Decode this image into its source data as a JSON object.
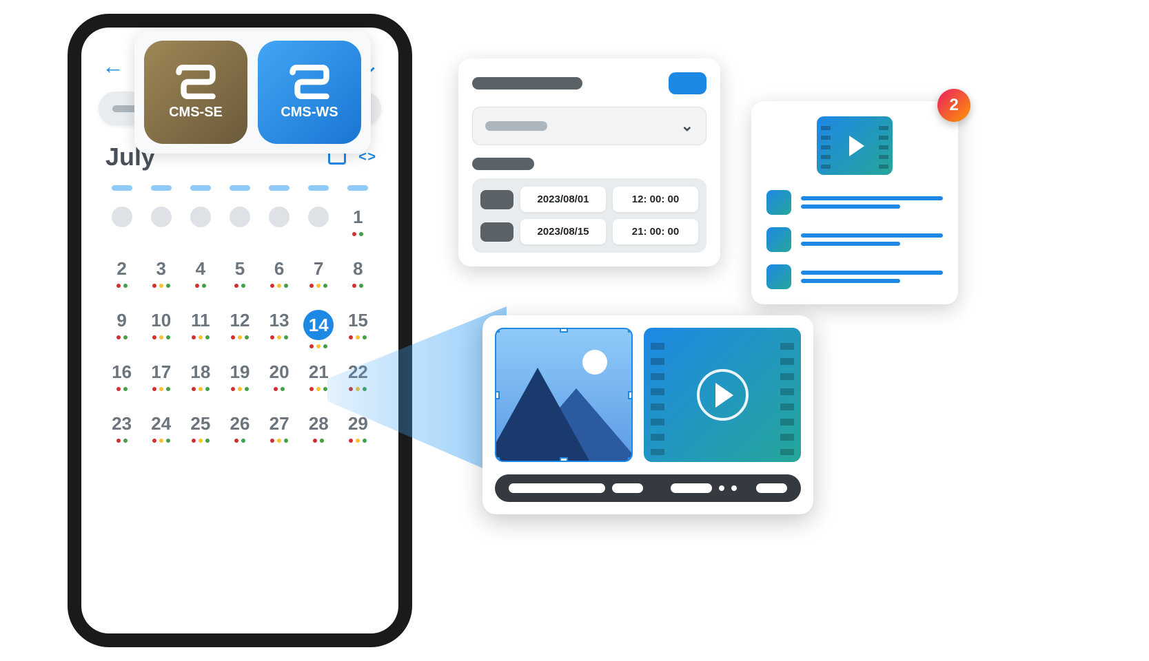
{
  "apps": {
    "cms_se": "CMS-SE",
    "cms_ws": "CMS-WS"
  },
  "calendar": {
    "month": "July",
    "selected_day": 14,
    "grid": [
      {
        "n": null,
        "dots": []
      },
      {
        "n": null,
        "dots": []
      },
      {
        "n": null,
        "dots": []
      },
      {
        "n": null,
        "dots": []
      },
      {
        "n": null,
        "dots": []
      },
      {
        "n": null,
        "dots": []
      },
      {
        "n": 1,
        "dots": [
          "r",
          "g"
        ]
      },
      {
        "n": 2,
        "dots": [
          "r",
          "g"
        ]
      },
      {
        "n": 3,
        "dots": [
          "r",
          "y",
          "g"
        ]
      },
      {
        "n": 4,
        "dots": [
          "r",
          "g"
        ]
      },
      {
        "n": 5,
        "dots": [
          "r",
          "g"
        ]
      },
      {
        "n": 6,
        "dots": [
          "r",
          "y",
          "g"
        ]
      },
      {
        "n": 7,
        "dots": [
          "r",
          "y",
          "g"
        ]
      },
      {
        "n": 8,
        "dots": [
          "r",
          "g"
        ]
      },
      {
        "n": 9,
        "dots": [
          "r",
          "g"
        ]
      },
      {
        "n": 10,
        "dots": [
          "r",
          "y",
          "g"
        ]
      },
      {
        "n": 11,
        "dots": [
          "r",
          "y",
          "g"
        ]
      },
      {
        "n": 12,
        "dots": [
          "r",
          "y",
          "g"
        ]
      },
      {
        "n": 13,
        "dots": [
          "r",
          "y",
          "g"
        ]
      },
      {
        "n": 14,
        "dots": [
          "r",
          "y",
          "g"
        ],
        "selected": true
      },
      {
        "n": 15,
        "dots": [
          "r",
          "y",
          "g"
        ]
      },
      {
        "n": 16,
        "dots": [
          "r",
          "g"
        ]
      },
      {
        "n": 17,
        "dots": [
          "r",
          "y",
          "g"
        ]
      },
      {
        "n": 18,
        "dots": [
          "r",
          "y",
          "g"
        ]
      },
      {
        "n": 19,
        "dots": [
          "r",
          "y",
          "g"
        ]
      },
      {
        "n": 20,
        "dots": [
          "r",
          "g"
        ]
      },
      {
        "n": 21,
        "dots": [
          "r",
          "y",
          "g"
        ]
      },
      {
        "n": 22,
        "dots": [
          "r",
          "y",
          "g"
        ]
      },
      {
        "n": 23,
        "dots": [
          "r",
          "g"
        ]
      },
      {
        "n": 24,
        "dots": [
          "r",
          "y",
          "g"
        ]
      },
      {
        "n": 25,
        "dots": [
          "r",
          "y",
          "g"
        ]
      },
      {
        "n": 26,
        "dots": [
          "r",
          "g"
        ]
      },
      {
        "n": 27,
        "dots": [
          "r",
          "y",
          "g"
        ]
      },
      {
        "n": 28,
        "dots": [
          "r",
          "g"
        ]
      },
      {
        "n": 29,
        "dots": [
          "r",
          "y",
          "g"
        ]
      }
    ]
  },
  "schedule": {
    "rows": [
      {
        "date": "2023/08/01",
        "time": "12: 00: 00"
      },
      {
        "date": "2023/08/15",
        "time": "21: 00: 00"
      }
    ]
  },
  "playlist": {
    "badge": "2",
    "item_count": 3
  }
}
